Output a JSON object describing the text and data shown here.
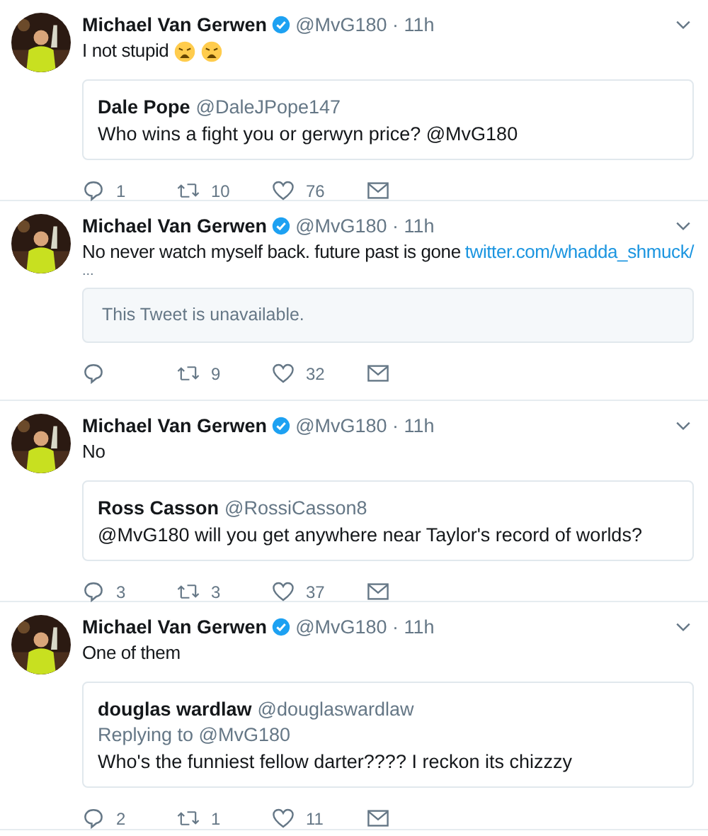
{
  "tweets": [
    {
      "author": "Michael Van Gerwen",
      "verified": true,
      "meta": "@MvG180 · 11h",
      "body": [
        {
          "kind": "text",
          "text": "I not stupid"
        },
        {
          "kind": "emoji"
        },
        {
          "kind": "emoji"
        }
      ],
      "quote": {
        "kind": "tweet",
        "author": "Dale Pope",
        "handle": "@DaleJPope147",
        "text": "Who wins a fight you or gerwyn price? @MvG180"
      },
      "replies": "1",
      "retweets": "10",
      "likes": "76"
    },
    {
      "author": "Michael Van Gerwen",
      "verified": true,
      "meta": "@MvG180 · 11h",
      "body": [
        {
          "kind": "text",
          "text": "No never watch myself back. future past is gone"
        },
        {
          "kind": "link",
          "text": "twitter.com/whadda_shmuck/"
        }
      ],
      "more": "...",
      "quote": {
        "kind": "unavailable",
        "text": "This Tweet is unavailable."
      },
      "retweets": "9",
      "likes": "32"
    },
    {
      "author": "Michael Van Gerwen",
      "verified": true,
      "meta": "@MvG180 · 11h",
      "body": [
        {
          "kind": "text",
          "text": "No"
        }
      ],
      "quote": {
        "kind": "tweet",
        "author": "Ross Casson",
        "handle": "@RossiCasson8",
        "text": "@MvG180 will you get anywhere near Taylor's record of worlds?"
      },
      "replies": "3",
      "retweets": "3",
      "likes": "37"
    },
    {
      "author": "Michael Van Gerwen",
      "verified": true,
      "meta": "@MvG180 · 11h",
      "body": [
        {
          "kind": "text",
          "text": "One of them"
        }
      ],
      "quote": {
        "kind": "tweet",
        "author": "douglas wardlaw",
        "handle": "@douglaswardlaw",
        "replying": "Replying to @MvG180",
        "text": "Who's the funniest fellow darter???? I reckon its chizzzy"
      },
      "replies": "2",
      "retweets": "1",
      "likes": "11"
    }
  ]
}
